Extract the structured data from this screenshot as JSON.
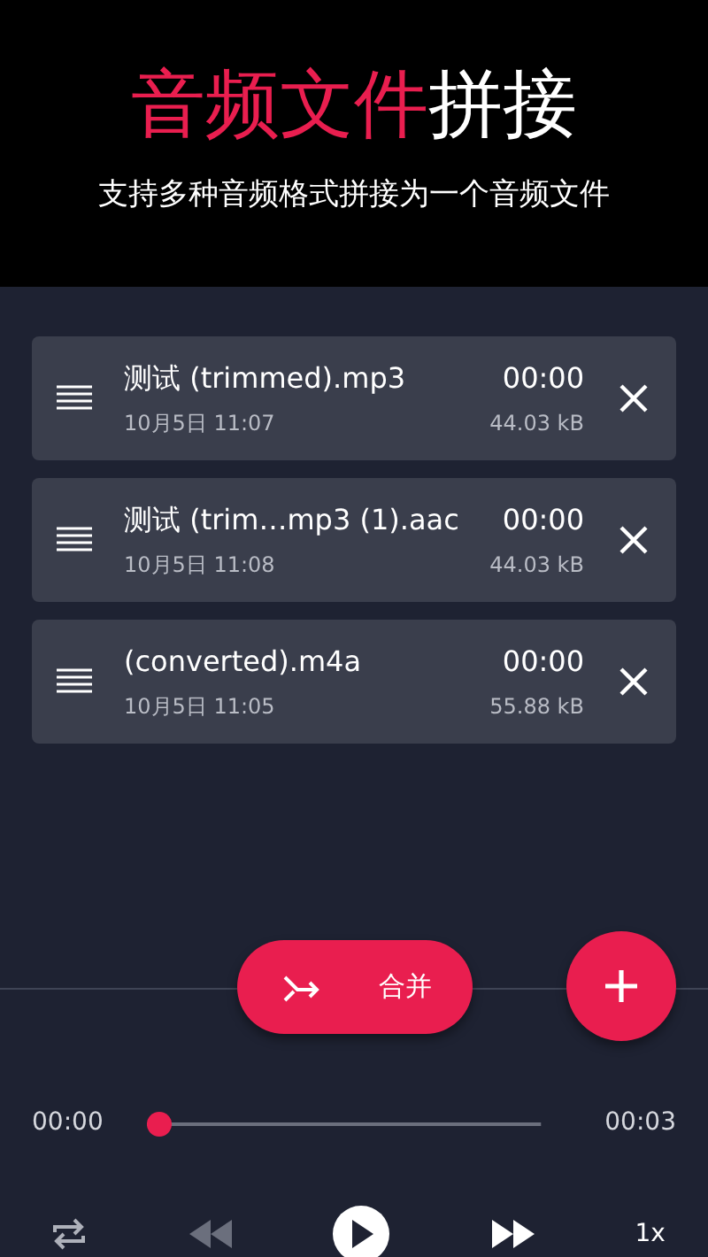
{
  "header": {
    "title_highlight": "音频文件",
    "title_rest": "拼接",
    "subtitle": "支持多种音频格式拼接为一个音频文件"
  },
  "files": [
    {
      "name": "测试 (trimmed).mp3",
      "date": "10月5日 11:07",
      "duration": "00:00",
      "size": "44.03 kB"
    },
    {
      "name": "测试 (trim…mp3 (1).aac",
      "date": "10月5日 11:08",
      "duration": "00:00",
      "size": "44.03 kB"
    },
    {
      "name": "(converted).m4a",
      "date": "10月5日 11:05",
      "duration": "00:00",
      "size": "55.88 kB"
    }
  ],
  "merge_button": {
    "label": "合并"
  },
  "player": {
    "elapsed": "00:00",
    "level": 0,
    "total": "00:03",
    "rewind_disabled": true,
    "speed": "1x"
  }
}
